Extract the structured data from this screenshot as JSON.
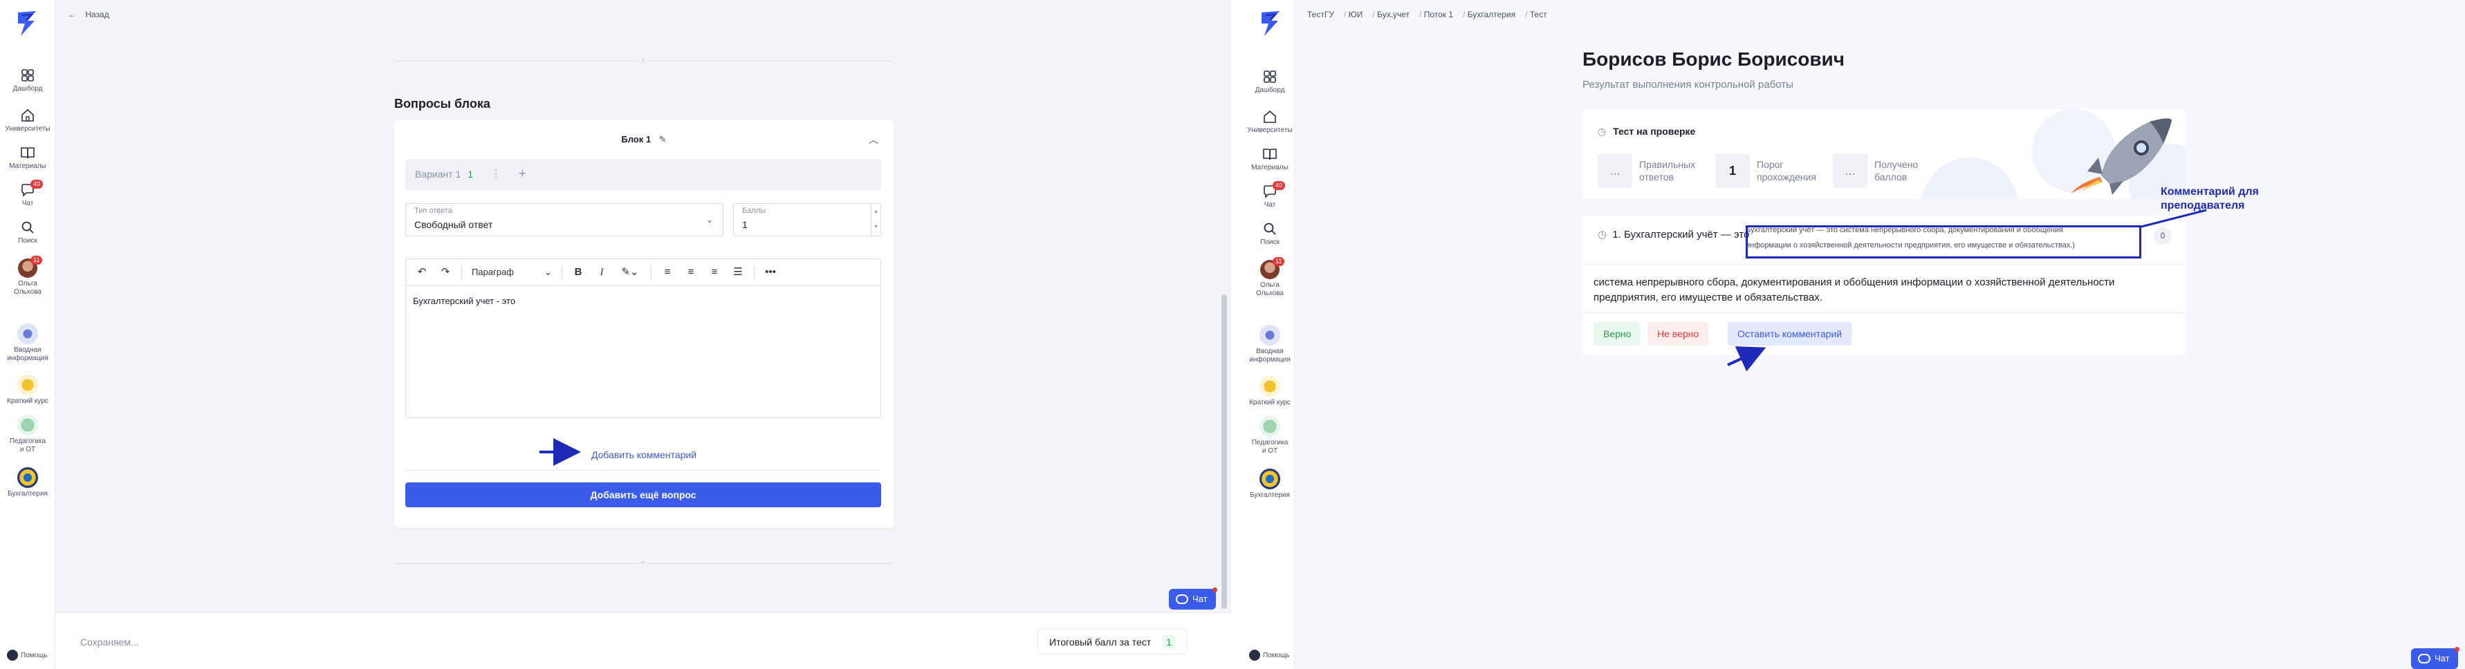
{
  "left": {
    "sidebar": {
      "items": [
        {
          "label": "Дашборд"
        },
        {
          "label": "Университеты"
        },
        {
          "label": "Материалы"
        },
        {
          "label": "Чат",
          "badge": "40"
        },
        {
          "label": "Поиск"
        },
        {
          "label": "Ольга Ольхова",
          "badge": "11"
        },
        {
          "label": "Вводная информация"
        },
        {
          "label": "Краткий курс"
        },
        {
          "label": "Педагогика и ОТ"
        },
        {
          "label": "Бухгалтерия"
        }
      ],
      "help": "Помощь"
    },
    "back": "Назад",
    "section_title": "Вопросы блока",
    "block": {
      "title": "Блок 1",
      "variant_label": "Вариант 1",
      "variant_count": "1",
      "answer_type_label": "Тип ответа",
      "answer_type_value": "Свободный ответ",
      "points_label": "Баллы",
      "points_value": "1",
      "paragraph_select": "Параграф",
      "editor_text": "Бухгалтерский учет - это",
      "add_comment": "Добавить комментарий",
      "add_question": "Добавить ещё вопрос"
    },
    "chat": "Чат",
    "footer": {
      "saving": "Сохраняем...",
      "total_label": "Итоговый балл за тест",
      "total_value": "1"
    }
  },
  "right": {
    "breadcrumb": [
      "ТестГУ",
      "ЮИ",
      "Бух.учет",
      "Поток 1",
      "Бухгалтерия",
      "Тест"
    ],
    "title": "Борисов Борис Борисович",
    "subtitle": "Результат выполнения контрольной работы",
    "status": {
      "title": "Тест на проверке",
      "correct_value": "...",
      "correct_label_1": "Правильных",
      "correct_label_2": "ответов",
      "threshold_value": "1",
      "threshold_label_1": "Порог",
      "threshold_label_2": "прохождения",
      "received_value": "...",
      "received_label_1": "Получено",
      "received_label_2": "баллов"
    },
    "question": {
      "title": "1. Бухгалтерский учёт — это",
      "hint_1": "Бухгалтерский учёт — это система непрерывного сбора, документирования и обобщения",
      "hint_2": "информации о хозяйственной деятельности предприятия, его имуществе и обязательствах.)",
      "score": "0",
      "answer_1": "система непрерывного сбора, документирования и обобщения информации о хозяйственной деятельности",
      "answer_2": "предприятия, его имуществе и обязательствах.",
      "correct_btn": "Верно",
      "incorrect_btn": "Не верно",
      "comment_btn": "Оставить комментарий"
    },
    "callout_1": "Комментарий для",
    "callout_2": "преподавателя",
    "help": "Помощь",
    "chat": "Чат"
  },
  "colors": {
    "accent": "#3b5bea",
    "annotation": "#1f2bb8",
    "success": "#2a9b4e",
    "danger": "#e23b3b"
  }
}
